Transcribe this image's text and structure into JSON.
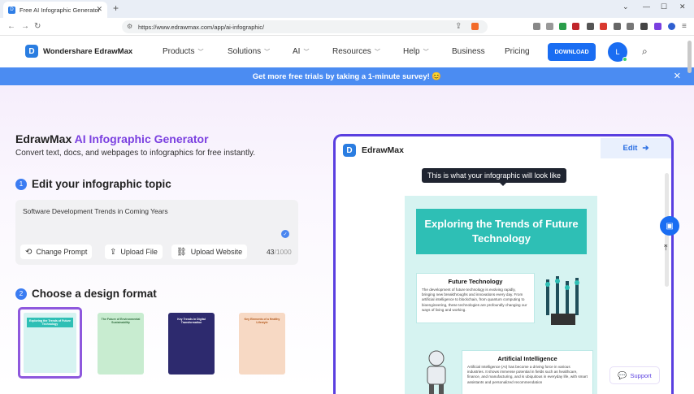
{
  "browser": {
    "tab_title": "Free AI Infographic Generator",
    "url": "https://www.edrawmax.com/app/ai-infographic/"
  },
  "header": {
    "logo_text": "Wondershare EdrawMax",
    "nav": [
      "Products",
      "Solutions",
      "AI",
      "Resources",
      "Help",
      "Business",
      "Pricing"
    ],
    "download_label": "DOWNLOAD",
    "avatar_initial": "L"
  },
  "banner": {
    "text": "Get more free trials by taking a 1-minute survey! 😊"
  },
  "hero": {
    "title_brand": "EdrawMax",
    "title_ai": "AI",
    "title_rest": "Infographic Generator",
    "subtitle": "Convert text, docs, and webpages to infographics for free instantly."
  },
  "step1": {
    "number": "1",
    "title": "Edit your infographic topic",
    "prompt_value": "Software Development Trends in Coming Years",
    "buttons": [
      "Change Prompt",
      "Upload File",
      "Upload Website"
    ],
    "count": "43",
    "max": "/1000"
  },
  "step2": {
    "number": "2",
    "title": "Choose a design format",
    "formats": [
      {
        "title": "Exploring the Trends of Future Technology",
        "color": "#d6f3f1"
      },
      {
        "title": "The Future of Environmental Sustainability",
        "color": "#c8ecd0"
      },
      {
        "title": "Key Trends in Digital Transformation",
        "color": "#2d2a6e"
      },
      {
        "title": "Key Elements of a Healthy Lifestyle",
        "color": "#f7d9c4"
      }
    ]
  },
  "preview": {
    "logo_text": "EdrawMax",
    "edit_label": "Edit",
    "tooltip": "This is what your infographic will look like",
    "infographic_title": "Exploring the Trends of Future Technology",
    "card1_title": "Future Technology",
    "card1_body": "The development of future technology is evolving rapidly, bringing new breakthroughs and innovations every day. From artificial intelligence to blockchain, from quantum computing to bioengineering, these technologies are profoundly changing our ways of living and working.",
    "card2_title": "Artificial Intelligence",
    "card2_body": "Artificial Intelligence (AI) has become a driving force in various industries. It shows immense potential in fields such as healthcare, finance, and manufacturing, and is ubiquitous in everyday life, with smart assistants and personalized recommendation"
  },
  "support_label": "Support",
  "colors": {
    "accent": "#1a6df2",
    "purple": "#7a3fe0",
    "teal": "#2ebfb5"
  }
}
